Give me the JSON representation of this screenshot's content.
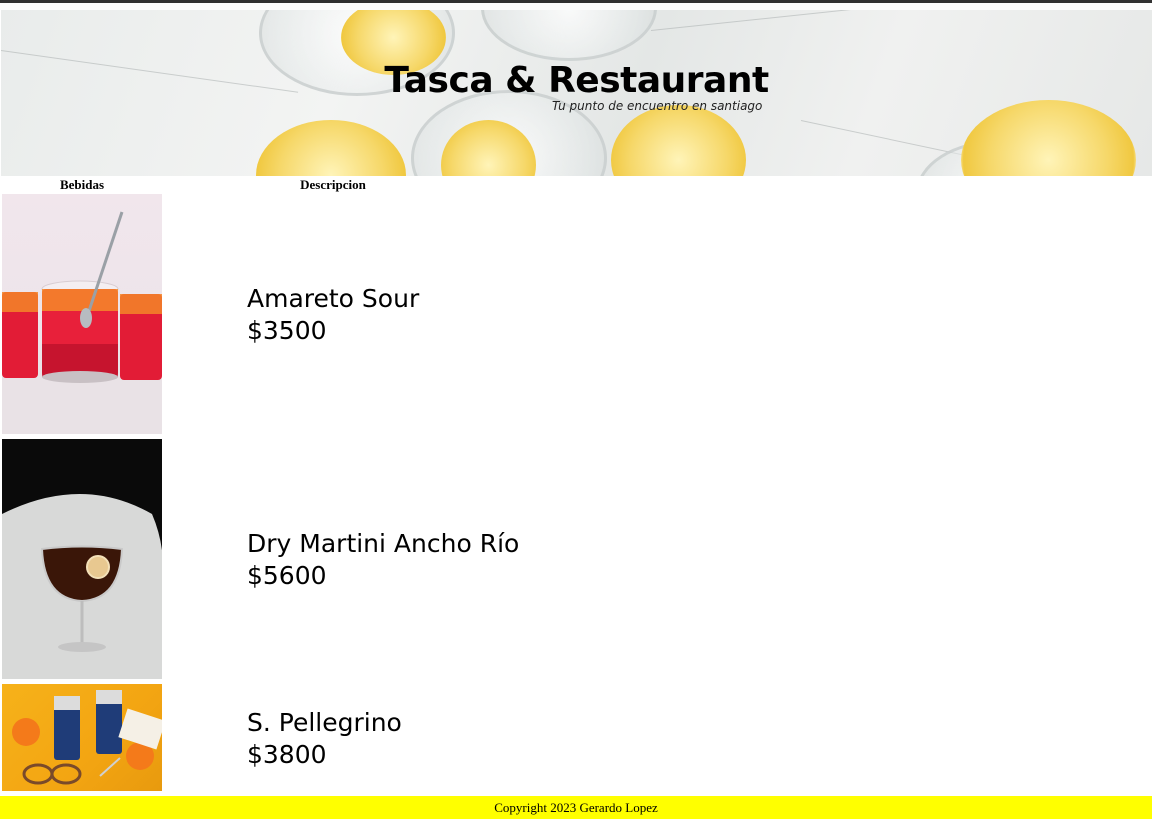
{
  "header": {
    "title": "Tasca & Restaurant",
    "subtitle": "Tu punto de encuentro en santiago"
  },
  "table": {
    "columns": [
      "Bebidas",
      "Descripcion"
    ],
    "rows": [
      {
        "name": "Amareto Sour",
        "price": "$3500",
        "image": "amaretto-sour-drinks-photo"
      },
      {
        "name": "Dry Martini Ancho Río",
        "price": "$5600",
        "image": "dry-martini-glass-photo"
      },
      {
        "name": "S. Pellegrino",
        "price": "$3800",
        "image": "san-pellegrino-cans-photo"
      }
    ]
  },
  "footer": {
    "copyright": "Copyright 2023 Gerardo Lopez"
  },
  "colors": {
    "footer_bg": "#ffff00",
    "top_bar": "#333333"
  }
}
